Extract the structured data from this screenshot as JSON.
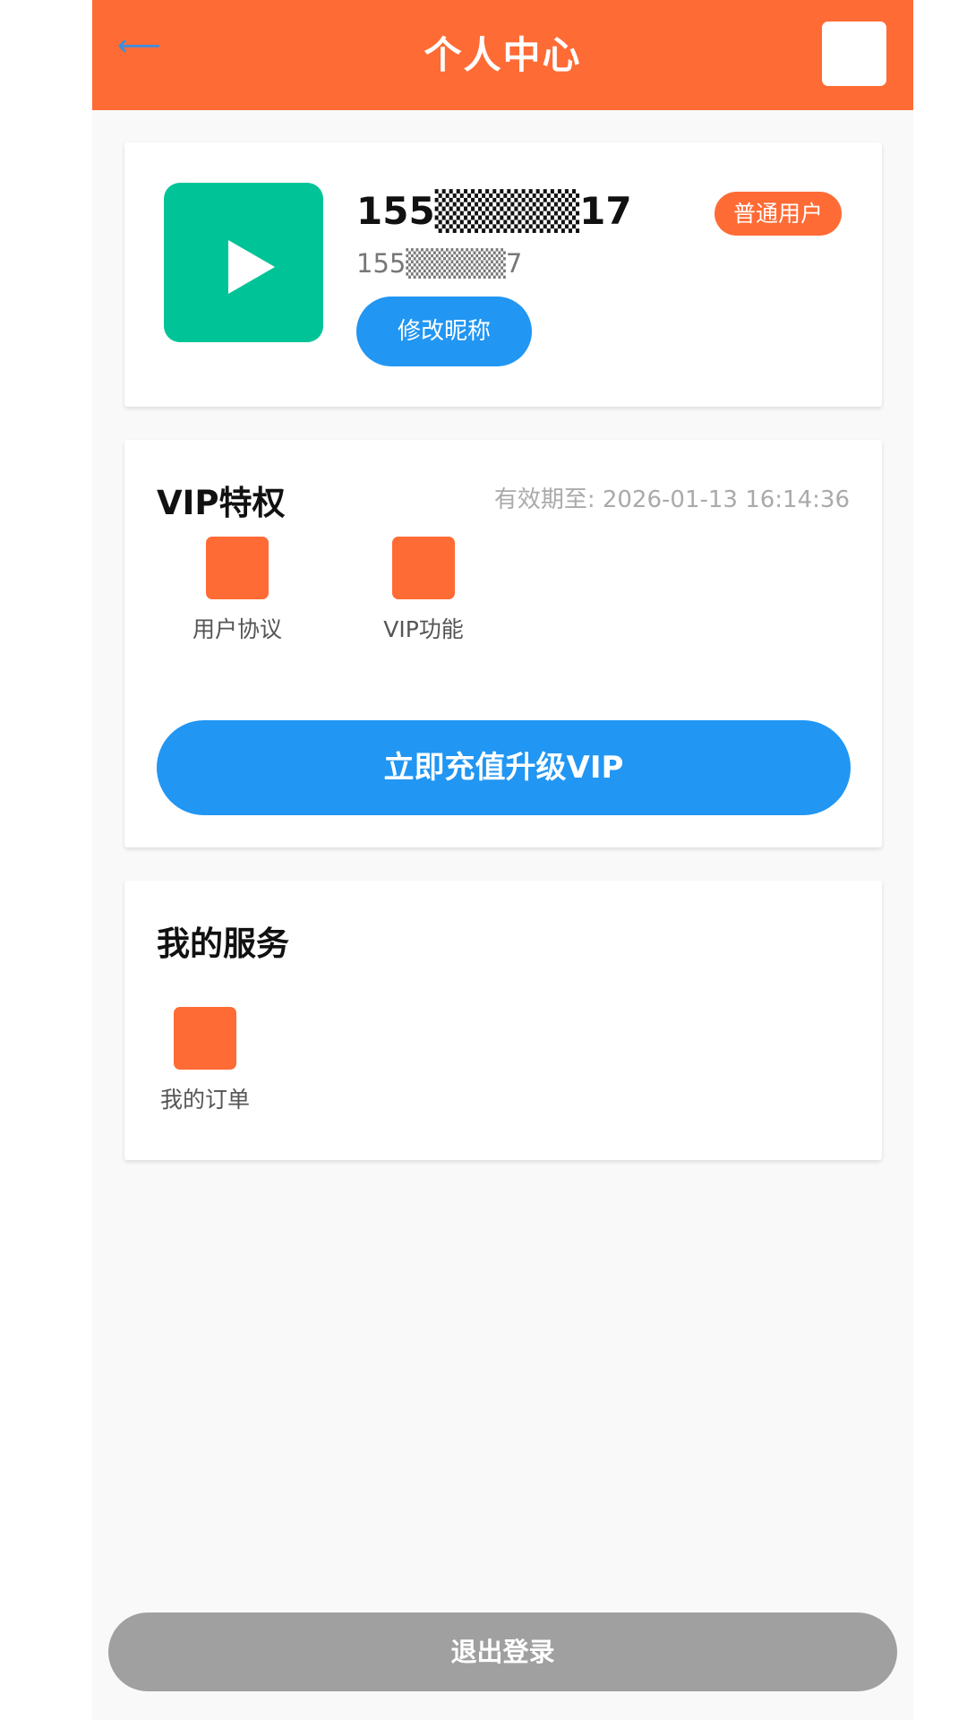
{
  "header": {
    "title": "个人中心",
    "back_arrow": "⟵"
  },
  "profile": {
    "nickname": "155▒▒▒▒▒17",
    "phone": "155▒▒▒▒▒7",
    "user_type": "普通用户",
    "edit_button": "修改昵称"
  },
  "vip": {
    "title": "VIP特权",
    "expiry": "有效期至: 2026-01-13 16:14:36",
    "features": [
      "用户协议",
      "VIP功能"
    ],
    "upgrade_button": "立即充值升级VIP"
  },
  "services": {
    "title": "我的服务",
    "items": [
      "我的订单"
    ]
  },
  "logout_button": "退出登录",
  "colors": {
    "header": "#ff6b35",
    "primary": "#2196f3",
    "avatar": "#00c497",
    "logout": "#a0a0a0"
  }
}
